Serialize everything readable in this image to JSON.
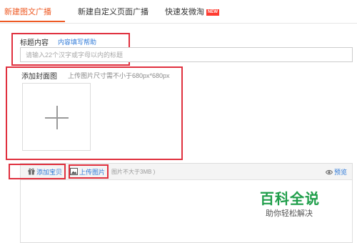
{
  "tabs": [
    {
      "label": "新建图文广播",
      "active": true
    },
    {
      "label": "新建自定义页面广播",
      "active": false
    },
    {
      "label": "快速发微淘",
      "active": false,
      "badge": "NEW"
    }
  ],
  "title_section": {
    "label": "标题内容",
    "help_link": "内容填写帮助",
    "input_placeholder": "请输入22个汉字或字母以内的标题",
    "input_value": ""
  },
  "cover_section": {
    "label": "添加封面图",
    "hint": "上传图片尺寸需不小于680px*680px"
  },
  "editor": {
    "add_item_label": "添加宝贝",
    "upload_image_label": "上传图片",
    "size_note": "图片不大于3MB )",
    "preview_label": "预览"
  },
  "watermark": {
    "title": "百科全说",
    "subtitle": "助你轻松解决"
  },
  "colors": {
    "accent": "#ee5a24",
    "link": "#2f7ad8",
    "annotation": "#e0303e",
    "badge": "#ff3b30",
    "watermark": "#1f9e4a"
  }
}
